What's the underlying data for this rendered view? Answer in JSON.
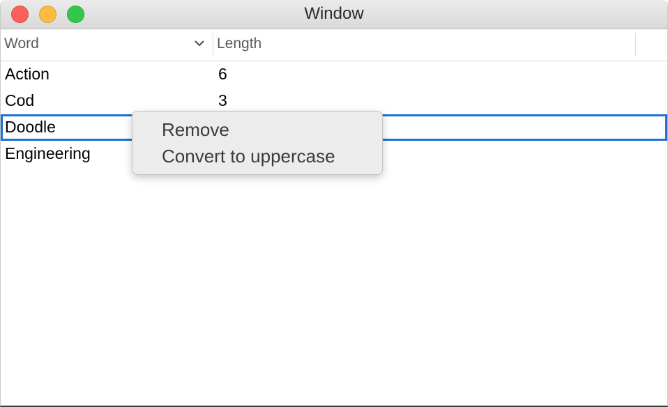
{
  "window": {
    "title": "Window"
  },
  "table": {
    "columns": [
      "Word",
      "Length"
    ],
    "rows": [
      {
        "word": "Action",
        "length": "6"
      },
      {
        "word": "Cod",
        "length": "3"
      },
      {
        "word": "Doodle",
        "length": ""
      },
      {
        "word": "Engineering",
        "length": ""
      }
    ],
    "selected_row_word": "Doodle"
  },
  "context_menu": {
    "items": [
      "Remove",
      "Convert to uppercase"
    ]
  },
  "colors": {
    "selection_border": "#1d6fd1",
    "close": "#fc605c",
    "minimize": "#fdbc40",
    "zoom": "#34c84a"
  },
  "icons": {
    "sort": "chevron-down-icon"
  }
}
